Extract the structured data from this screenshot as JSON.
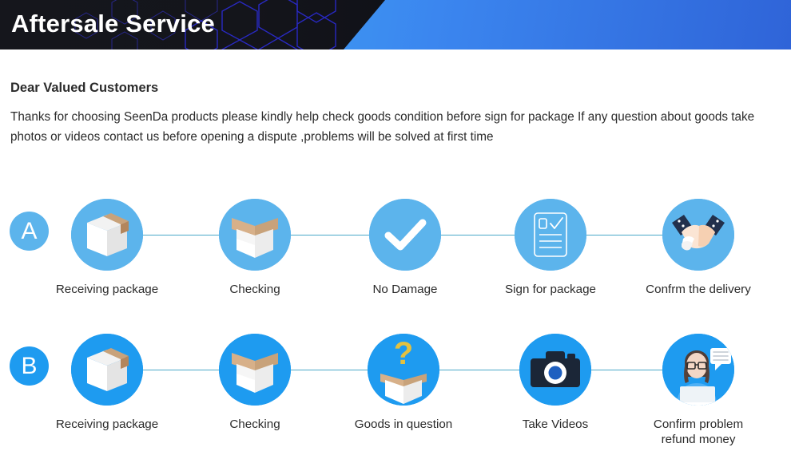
{
  "banner": {
    "title": "Aftersale Service",
    "dark_bg": "#15161c",
    "accent_gradient_from": "#4cc3f5",
    "accent_gradient_to": "#2f64d8",
    "hex_outline": "#2a2ab8"
  },
  "intro": {
    "heading": "Dear Valued Customers",
    "body": "Thanks for choosing SeenDa products please kindly help check goods condition before sign for package If any question about goods take photos or videos contact us before opening a dispute ,problems will be solved at first time"
  },
  "colors": {
    "row_a_blue": "#5cb4ec",
    "row_b_blue": "#1e9bf0",
    "rail": "#4aa8c9",
    "text": "#2b2b2b",
    "box_kraft": "#c8a27a",
    "box_white": "#ffffff",
    "question_mark": "#e3c13f",
    "camera_body": "#1b2637",
    "sleeve_navy": "#22304c",
    "hand_peach": "#f6d8c2"
  },
  "rows": [
    {
      "badge": "A",
      "badge_name": "flow-badge-a",
      "steps": [
        {
          "label": "Receiving package",
          "icon": "closed-box-icon"
        },
        {
          "label": "Checking",
          "icon": "open-box-icon"
        },
        {
          "label": "No Damage",
          "icon": "checkmark-icon"
        },
        {
          "label": "Sign for package",
          "icon": "signed-document-icon"
        },
        {
          "label": "Confrm the delivery",
          "icon": "handshake-icon"
        }
      ]
    },
    {
      "badge": "B",
      "badge_name": "flow-badge-b",
      "steps": [
        {
          "label": "Receiving package",
          "icon": "closed-box-icon"
        },
        {
          "label": "Checking",
          "icon": "open-box-icon"
        },
        {
          "label": "Goods in question",
          "icon": "question-box-icon"
        },
        {
          "label": "Take Videos",
          "icon": "camera-icon"
        },
        {
          "label": "Confirm problem\nrefund money",
          "icon": "support-agent-icon"
        }
      ]
    }
  ]
}
